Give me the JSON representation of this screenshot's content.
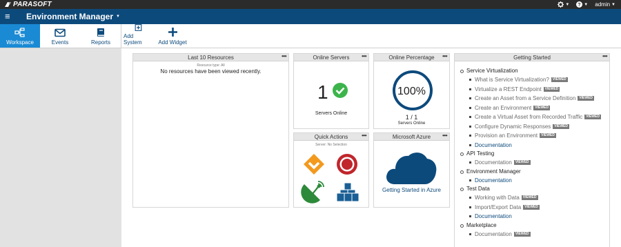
{
  "brand": {
    "name": "PARASOFT"
  },
  "topbar": {
    "settings_icon": "gear-icon",
    "help_icon": "help-icon",
    "user": "admin"
  },
  "header": {
    "title": "Environment Manager"
  },
  "nav": {
    "tabs": [
      {
        "label": "Workspace",
        "icon": "workspace-icon",
        "active": true
      },
      {
        "label": "Events",
        "icon": "envelope-icon",
        "active": false
      },
      {
        "label": "Reports",
        "icon": "book-icon",
        "active": false
      }
    ],
    "actions": [
      {
        "label": "Add System",
        "icon": "plus-box-icon"
      },
      {
        "label": "Add Widget",
        "icon": "plus-icon"
      }
    ]
  },
  "widgets": {
    "resources": {
      "title": "Last 10 Resources",
      "subtitle": "Resource type: All",
      "message": "No resources have been viewed recently."
    },
    "online_servers": {
      "title": "Online Servers",
      "count": "1",
      "caption": "Servers Online"
    },
    "online_percentage": {
      "title": "Online Percentage",
      "percent": "100%",
      "fraction": "1 / 1",
      "caption": "Servers Online",
      "value": 1.0
    },
    "quick_actions": {
      "title": "Quick Actions",
      "subtitle": "Server: No Selection"
    },
    "azure": {
      "title": "Microsoft Azure",
      "link": "Getting Started in Azure"
    },
    "getting_started": {
      "title": "Getting Started",
      "badge": "VIEWED",
      "sections": [
        {
          "title": "Service Virtualization",
          "items": [
            {
              "label": "What is Service Virtualization?",
              "viewed": true
            },
            {
              "label": "Virtualize a REST Endpoint",
              "viewed": true
            },
            {
              "label": "Create an Asset from a Service Definition",
              "viewed": true
            },
            {
              "label": "Create an Environment",
              "viewed": true
            },
            {
              "label": "Create a Virtual Asset from Recorded Traffic",
              "viewed": true
            },
            {
              "label": "Configure Dynamic Responses",
              "viewed": true
            },
            {
              "label": "Provision an Environment",
              "viewed": true
            },
            {
              "label": "Documentation",
              "viewed": false
            }
          ]
        },
        {
          "title": "API Testing",
          "items": [
            {
              "label": "Documentation",
              "viewed": true
            }
          ]
        },
        {
          "title": "Environment Manager",
          "items": [
            {
              "label": "Documentation",
              "viewed": false
            }
          ]
        },
        {
          "title": "Test Data",
          "items": [
            {
              "label": "Working with Data",
              "viewed": true
            },
            {
              "label": "Import/Export Data",
              "viewed": true
            },
            {
              "label": "Documentation",
              "viewed": false
            }
          ]
        },
        {
          "title": "Marketplace",
          "items": [
            {
              "label": "Documentation",
              "viewed": true
            }
          ]
        }
      ]
    }
  },
  "colors": {
    "navy": "#0d4a7c",
    "active_tab": "#1a8ad4",
    "green": "#3cb44b",
    "orange": "#f39a1e",
    "red": "#c0262c",
    "dark_green": "#2d8a3a",
    "blue_cubes": "#1a5f95"
  }
}
